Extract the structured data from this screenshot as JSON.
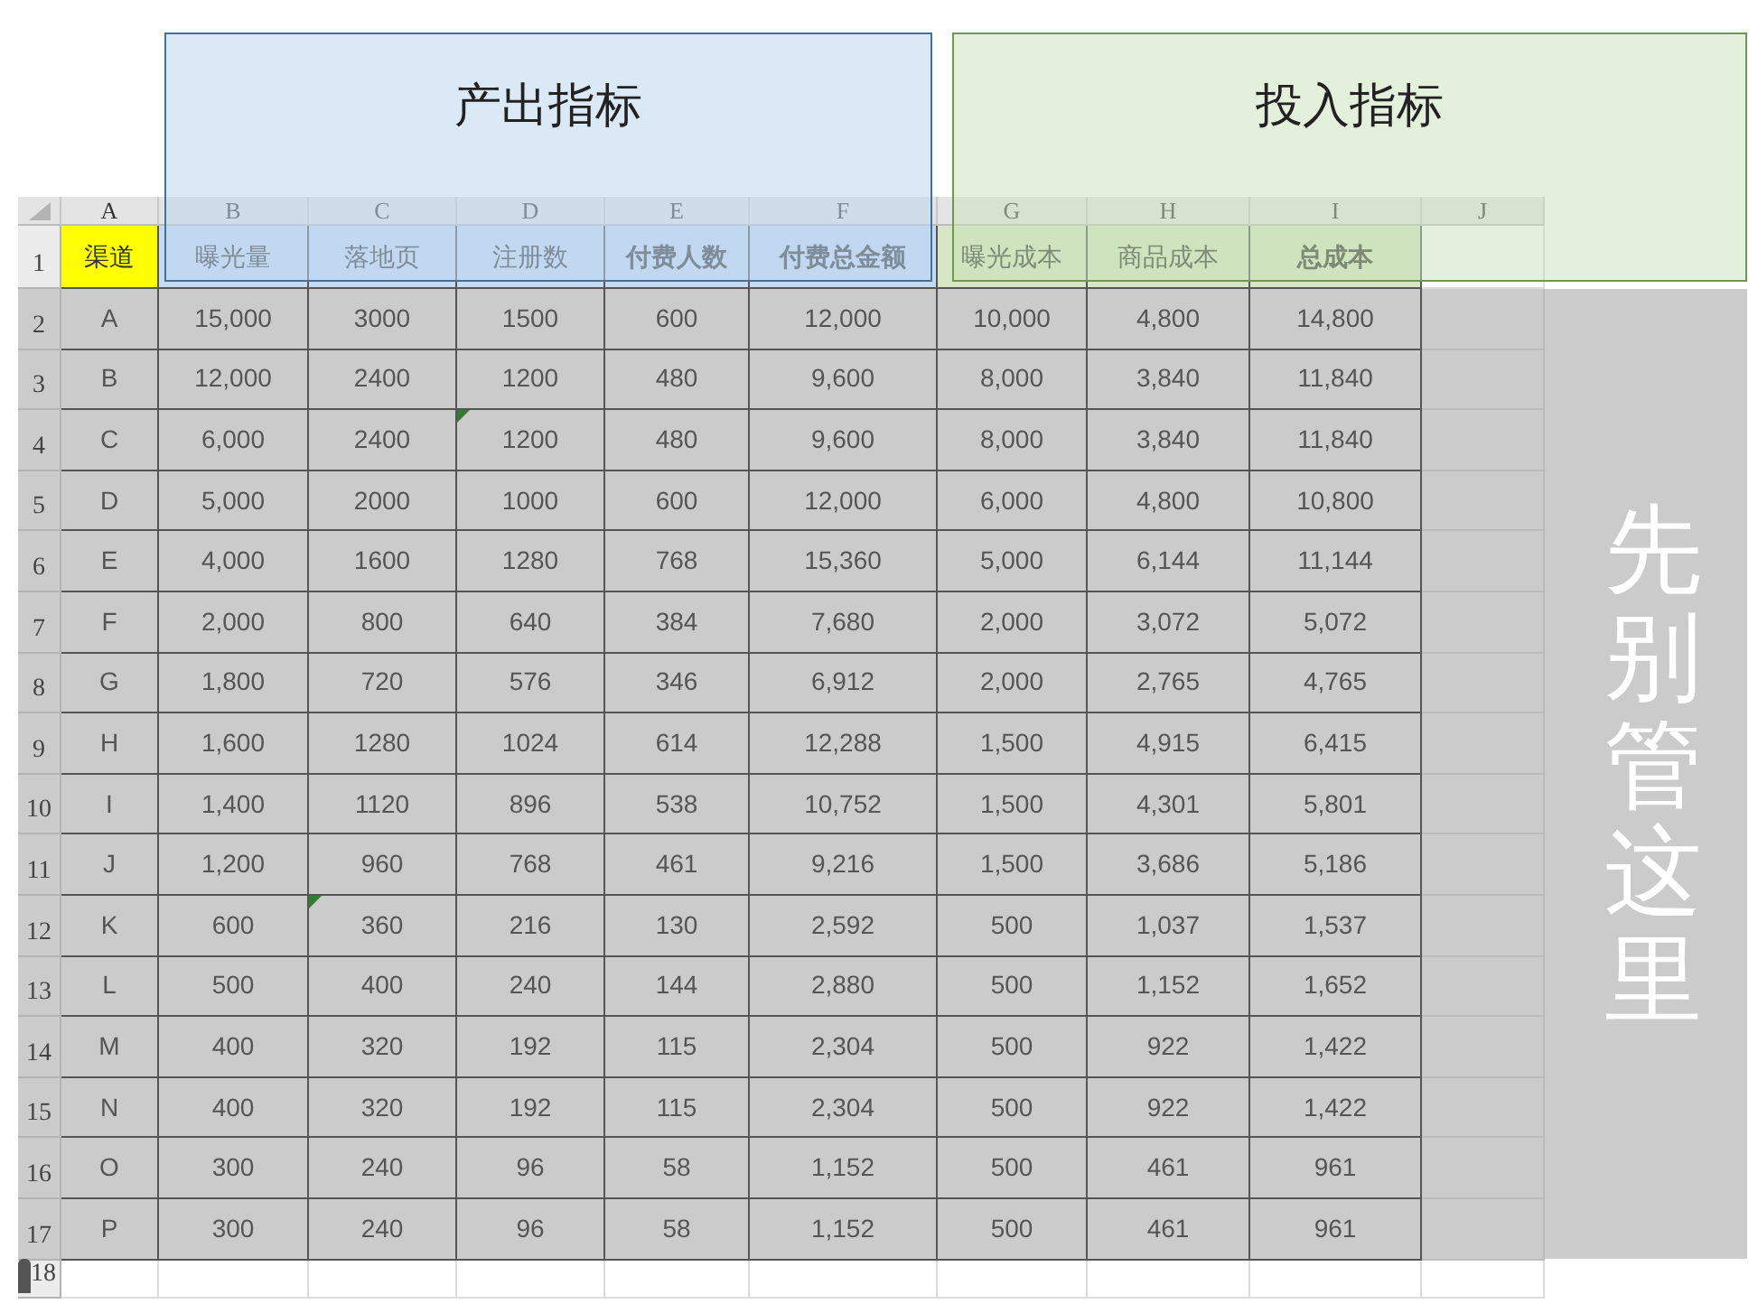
{
  "groups": [
    {
      "title": "产出指标",
      "kind": "output"
    },
    {
      "title": "投入指标",
      "kind": "input"
    }
  ],
  "column_letters": [
    "A",
    "B",
    "C",
    "D",
    "E",
    "F",
    "G",
    "H",
    "I",
    "J"
  ],
  "row_numbers": [
    "1",
    "2",
    "3",
    "4",
    "5",
    "6",
    "7",
    "8",
    "9",
    "10",
    "11",
    "12",
    "13",
    "14",
    "15",
    "16",
    "17",
    "18"
  ],
  "header": [
    {
      "text": "渠道",
      "bold": false,
      "color": "#ffff00"
    },
    {
      "text": "曝光量",
      "bold": false,
      "color": "#c5d9f1"
    },
    {
      "text": "落地页",
      "bold": false,
      "color": "#c5d9f1"
    },
    {
      "text": "注册数",
      "bold": false,
      "color": "#c5d9f1"
    },
    {
      "text": "付费人数",
      "bold": true,
      "color": "#c5d9f1"
    },
    {
      "text": "付费总金额",
      "bold": true,
      "color": "#c5d9f1"
    },
    {
      "text": "曝光成本",
      "bold": false,
      "color": "#d6e6c4"
    },
    {
      "text": "商品成本",
      "bold": false,
      "color": "#d6e6c4"
    },
    {
      "text": "总成本",
      "bold": true,
      "color": "#d6e6c4"
    }
  ],
  "rows": [
    {
      "cells": [
        "A",
        "15,000",
        "3000",
        "1500",
        "600",
        "12,000",
        "10,000",
        "4,800",
        "14,800"
      ],
      "flags": [
        false,
        false,
        false,
        false,
        false,
        false,
        false,
        false,
        false
      ]
    },
    {
      "cells": [
        "B",
        "12,000",
        "2400",
        "1200",
        "480",
        "9,600",
        "8,000",
        "3,840",
        "11,840"
      ],
      "flags": [
        false,
        false,
        false,
        false,
        false,
        false,
        false,
        false,
        false
      ]
    },
    {
      "cells": [
        "C",
        "6,000",
        "2400",
        "1200",
        "480",
        "9,600",
        "8,000",
        "3,840",
        "11,840"
      ],
      "flags": [
        false,
        false,
        false,
        true,
        false,
        false,
        false,
        false,
        false
      ]
    },
    {
      "cells": [
        "D",
        "5,000",
        "2000",
        "1000",
        "600",
        "12,000",
        "6,000",
        "4,800",
        "10,800"
      ],
      "flags": [
        false,
        false,
        false,
        false,
        false,
        false,
        false,
        false,
        false
      ]
    },
    {
      "cells": [
        "E",
        "4,000",
        "1600",
        "1280",
        "768",
        "15,360",
        "5,000",
        "6,144",
        "11,144"
      ],
      "flags": [
        false,
        false,
        false,
        false,
        false,
        false,
        false,
        false,
        false
      ]
    },
    {
      "cells": [
        "F",
        "2,000",
        "800",
        "640",
        "384",
        "7,680",
        "2,000",
        "3,072",
        "5,072"
      ],
      "flags": [
        false,
        false,
        false,
        false,
        false,
        false,
        false,
        false,
        false
      ]
    },
    {
      "cells": [
        "G",
        "1,800",
        "720",
        "576",
        "346",
        "6,912",
        "2,000",
        "2,765",
        "4,765"
      ],
      "flags": [
        false,
        false,
        false,
        false,
        false,
        false,
        false,
        false,
        false
      ]
    },
    {
      "cells": [
        "H",
        "1,600",
        "1280",
        "1024",
        "614",
        "12,288",
        "1,500",
        "4,915",
        "6,415"
      ],
      "flags": [
        false,
        false,
        false,
        false,
        false,
        false,
        false,
        false,
        false
      ]
    },
    {
      "cells": [
        "I",
        "1,400",
        "1120",
        "896",
        "538",
        "10,752",
        "1,500",
        "4,301",
        "5,801"
      ],
      "flags": [
        false,
        false,
        false,
        false,
        false,
        false,
        false,
        false,
        false
      ]
    },
    {
      "cells": [
        "J",
        "1,200",
        "960",
        "768",
        "461",
        "9,216",
        "1,500",
        "3,686",
        "5,186"
      ],
      "flags": [
        false,
        false,
        false,
        false,
        false,
        false,
        false,
        false,
        false
      ]
    },
    {
      "cells": [
        "K",
        "600",
        "360",
        "216",
        "130",
        "2,592",
        "500",
        "1,037",
        "1,537"
      ],
      "flags": [
        false,
        false,
        true,
        false,
        false,
        false,
        false,
        false,
        false
      ]
    },
    {
      "cells": [
        "L",
        "500",
        "400",
        "240",
        "144",
        "2,880",
        "500",
        "1,152",
        "1,652"
      ],
      "flags": [
        false,
        false,
        false,
        false,
        false,
        false,
        false,
        false,
        false
      ]
    },
    {
      "cells": [
        "M",
        "400",
        "320",
        "192",
        "115",
        "2,304",
        "500",
        "922",
        "1,422"
      ],
      "flags": [
        false,
        false,
        false,
        false,
        false,
        false,
        false,
        false,
        false
      ]
    },
    {
      "cells": [
        "N",
        "400",
        "320",
        "192",
        "115",
        "2,304",
        "500",
        "922",
        "1,422"
      ],
      "flags": [
        false,
        false,
        false,
        false,
        false,
        false,
        false,
        false,
        false
      ]
    },
    {
      "cells": [
        "O",
        "300",
        "240",
        "96",
        "58",
        "1,152",
        "500",
        "461",
        "961"
      ],
      "flags": [
        false,
        false,
        false,
        false,
        false,
        false,
        false,
        false,
        false
      ]
    },
    {
      "cells": [
        "P",
        "300",
        "240",
        "96",
        "58",
        "1,152",
        "500",
        "461",
        "961"
      ],
      "flags": [
        false,
        false,
        false,
        false,
        false,
        false,
        false,
        false,
        false
      ]
    }
  ],
  "shade_note": "先别管这里"
}
